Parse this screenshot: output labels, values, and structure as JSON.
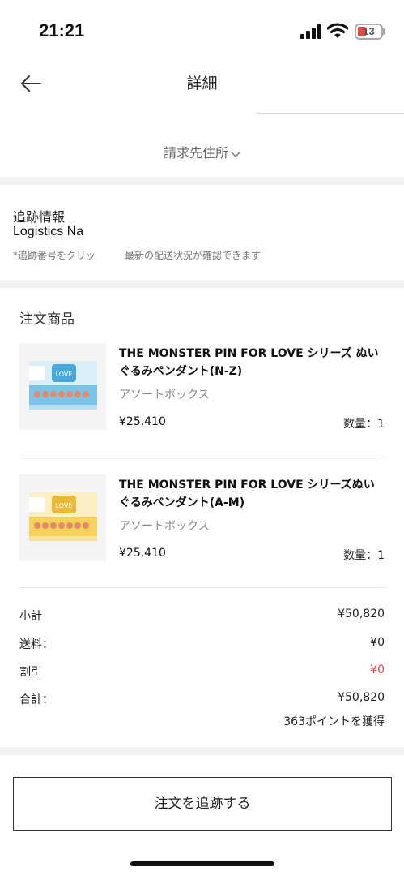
{
  "status_bar": {
    "time": "21:21",
    "battery": "13",
    "battery_color": "#e5484d"
  },
  "nav": {
    "back_icon": "arrow-left-icon",
    "title": "詳細"
  },
  "billing": {
    "label": "請求先住所",
    "icon": "chevron-down-icon"
  },
  "tracking": {
    "title": "追跡情報",
    "value": "Logistics Na",
    "note": "*追跡番号をクリッ　　　最新の配送状況が確認できます"
  },
  "order": {
    "section_title": "注文商品",
    "items": [
      {
        "name": "THE MONSTER PIN FOR LOVE シリーズ ぬいぐるみペンダント(N-Z)",
        "variant": "アソートボックス",
        "price": "¥25,410",
        "qty": "数量：1",
        "theme_color": "#7bc3e8"
      },
      {
        "name": "THE MONSTER PIN FOR LOVE シリーズぬいぐるみペンダント(A-M)",
        "variant": "アソートボックス",
        "price": "¥25,410",
        "qty": "数量：1",
        "theme_color": "#f3d35b"
      }
    ]
  },
  "summary": {
    "subtotal_label": "小計",
    "subtotal": "¥50,820",
    "shipping_label": "送料：",
    "shipping": "¥0",
    "discount_label": "割引",
    "discount": "¥0",
    "discount_color": "#e5484d",
    "total_label": "合計：",
    "total": "¥50,820",
    "points": "363ポイントを獲得"
  },
  "actions": {
    "track_order": "注文を追跡する"
  }
}
